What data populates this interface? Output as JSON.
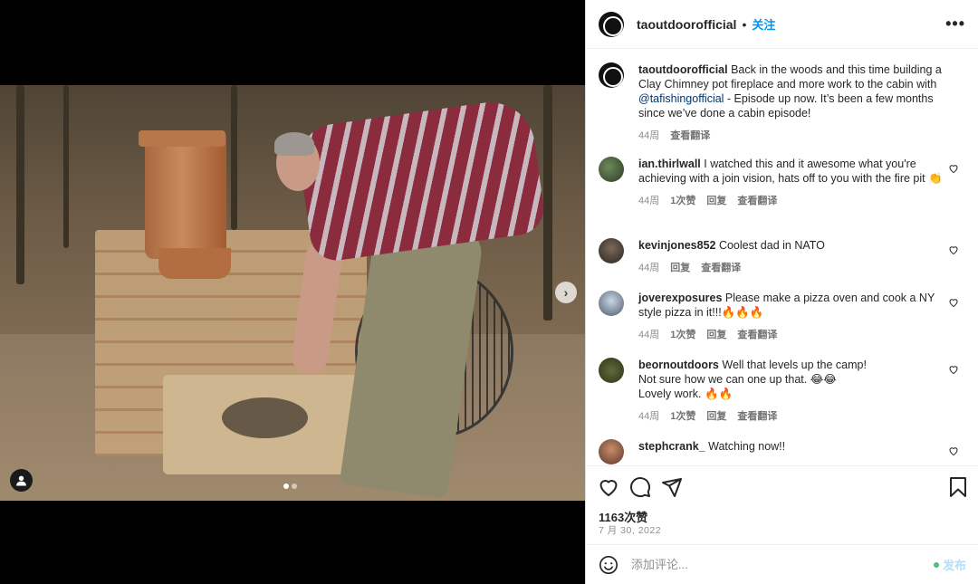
{
  "post": {
    "username": "taoutdoorofficial",
    "bullet": "•",
    "follow_label": "关注",
    "more_label": "•••",
    "next_label": "›",
    "carousel_count": 2,
    "carousel_active": 0
  },
  "caption": {
    "username": "taoutdoorofficial",
    "text_before": "Back in the woods and this time building a Clay Chimney pot fireplace and more work to the cabin with ",
    "mention": "@tafishingofficial",
    "text_after": " - Episode up now. It’s been a few months since we’ve done a cabin episode!",
    "age": "44周",
    "translate": "查看翻译"
  },
  "comments": [
    {
      "username": "ian.thirlwall",
      "text": "I watched this and it awesome what you're achieving with a join vision, hats off to you with the fire pit 👏",
      "age": "44周",
      "likes": "1次赞",
      "reply": "回复",
      "translate": "查看翻译"
    },
    {
      "username": "kevinjones852",
      "text": "Coolest dad in NATO",
      "age": "44周",
      "reply": "回复",
      "translate": "查看翻译"
    },
    {
      "username": "joverexposures",
      "text": "Please make a pizza oven and cook a NY style pizza in it!!!🔥🔥🔥",
      "age": "44周",
      "likes": "1次赞",
      "reply": "回复",
      "translate": "查看翻译"
    },
    {
      "username": "beornoutdoors",
      "text_line1": "Well that levels up the camp!",
      "text_line2": "Not sure how we can one up that. 😂😂",
      "text_line3": "Lovely work. 🔥🔥",
      "age": "44周",
      "likes": "1次赞",
      "reply": "回复",
      "translate": "查看翻译"
    },
    {
      "username": "stephcrank_",
      "text": "Watching now!!"
    }
  ],
  "stats": {
    "likes": "1163次赞",
    "date": "7 月 30, 2022"
  },
  "composer": {
    "placeholder": "添加评论...",
    "post_label": "发布"
  }
}
